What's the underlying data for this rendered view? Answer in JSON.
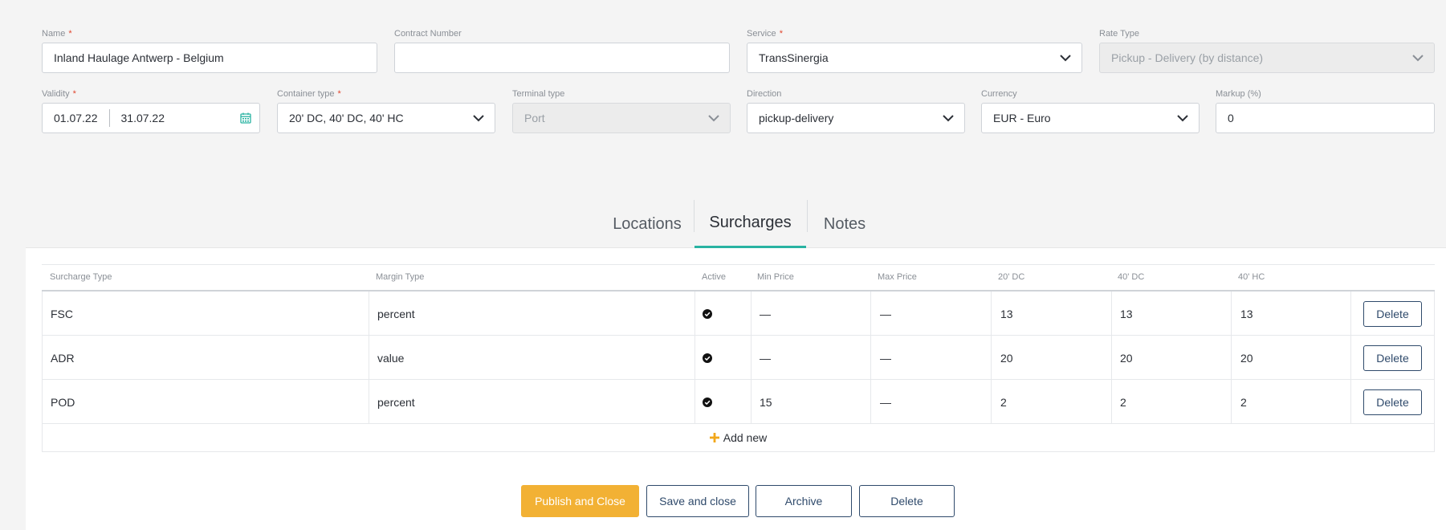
{
  "form": {
    "name": {
      "label": "Name",
      "value": "Inland Haulage Antwerp - Belgium"
    },
    "contract_number": {
      "label": "Contract Number",
      "value": ""
    },
    "service": {
      "label": "Service",
      "value": "TransSinergia"
    },
    "rate_type": {
      "label": "Rate Type",
      "value": "Pickup - Delivery (by distance)"
    },
    "validity": {
      "label": "Validity",
      "from": "01.07.22",
      "to": "31.07.22"
    },
    "container_type": {
      "label": "Container type",
      "value": "20' DC, 40' DC, 40' HC"
    },
    "terminal_type": {
      "label": "Terminal type",
      "value": "Port"
    },
    "direction": {
      "label": "Direction",
      "value": "pickup-delivery"
    },
    "currency": {
      "label": "Currency",
      "value": "EUR - Euro"
    },
    "markup": {
      "label": "Markup (%)",
      "value": "0"
    },
    "required_marker": "*"
  },
  "tabs": [
    {
      "label": "Locations",
      "active": false
    },
    {
      "label": "Surcharges",
      "active": true
    },
    {
      "label": "Notes",
      "active": false
    }
  ],
  "surcharges": {
    "columns": [
      "Surcharge Type",
      "Margin Type",
      "Active",
      "Min Price",
      "Max Price",
      "20' DC",
      "40' DC",
      "40' HC"
    ],
    "rows": [
      {
        "type": "FSC",
        "margin": "percent",
        "active": true,
        "min": "—",
        "max": "—",
        "dc20": "13",
        "dc40": "13",
        "hc40": "13"
      },
      {
        "type": "ADR",
        "margin": "value",
        "active": true,
        "min": "—",
        "max": "—",
        "dc20": "20",
        "dc40": "20",
        "hc40": "20"
      },
      {
        "type": "POD",
        "margin": "percent",
        "active": true,
        "min": "15",
        "max": "—",
        "dc20": "2",
        "dc40": "2",
        "hc40": "2"
      }
    ],
    "row_delete_label": "Delete",
    "add_new_label": "Add new"
  },
  "actions": {
    "publish_label": "Publish and Close",
    "save_label": "Save and close",
    "archive_label": "Archive",
    "delete_label": "Delete"
  },
  "colors": {
    "accent_teal": "#29b3a2",
    "primary_yellow": "#f2b134",
    "outline_navy": "#2f4a6b",
    "required_red": "#e0462e"
  },
  "icons": {
    "dropdown": "chevron-down-icon",
    "calendar": "calendar-icon",
    "active": "check-circle-icon",
    "add": "plus-icon"
  }
}
